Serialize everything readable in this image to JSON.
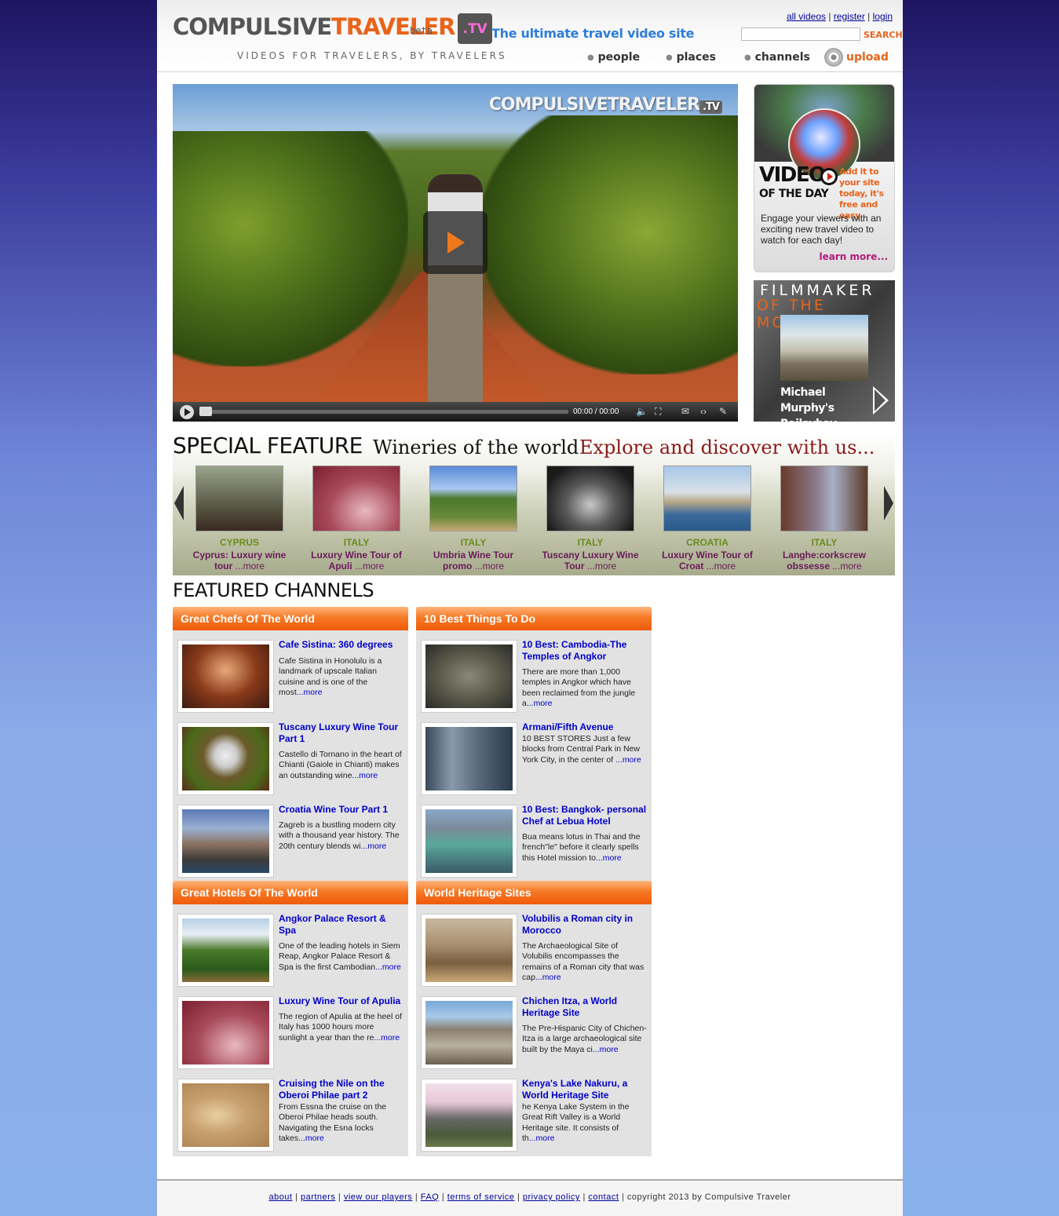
{
  "header": {
    "logo_part1": "COMPULSIVE",
    "logo_part2": "TRAVELER",
    "logo_tv": ".TV",
    "beta": "beta",
    "sub_tagline": "VIDEOS FOR TRAVELERS, BY TRAVELERS",
    "main_tagline": "The ultimate travel video site",
    "links": {
      "all_videos": "all videos",
      "register": "register",
      "login": "login",
      "sep": "|"
    },
    "search": {
      "placeholder": "",
      "button": "SEARCH"
    },
    "nav": {
      "people": "people",
      "places": "places",
      "channels": "channels",
      "upload": "upload"
    }
  },
  "player": {
    "watermark": "COMPULSIVETRAVELER",
    "watermark_tv": ".TV",
    "time": "00:00 / 00:00"
  },
  "votd": {
    "title_line1": "VIDEO",
    "title_line2": "OF THE DAY",
    "add_text": "Add it to your site today, it's free and easy",
    "description": "Engage your viewers with an exciting new travel video to watch for each day!",
    "learn_more": "learn more..."
  },
  "fotm": {
    "title_line1": "FILMMAKER",
    "title_line2": "OF THE MONTH",
    "name": "Michael Murphy's Railaybay"
  },
  "special_feature": {
    "title": "SPECIAL FEATURE",
    "subtitle": "Wineries of the world",
    "tagline": "Explore and discover with us...",
    "items": [
      {
        "country": "CYPRUS",
        "caption": "Cyprus: Luxury wine tour",
        "more": "...more"
      },
      {
        "country": "ITALY",
        "caption": "Luxury Wine Tour of Apuli",
        "more": "...more"
      },
      {
        "country": "ITALY",
        "caption": "Umbria Wine Tour promo",
        "more": "...more"
      },
      {
        "country": "ITALY",
        "caption": "Tuscany Luxury Wine Tour",
        "more": "...more"
      },
      {
        "country": "CROATIA",
        "caption": "Luxury Wine Tour of Croat",
        "more": "...more"
      },
      {
        "country": "ITALY",
        "caption": "Langhe:corkscrew obssesse",
        "more": "...more"
      }
    ]
  },
  "featured_channels": {
    "title": "FEATURED CHANNELS",
    "channels": [
      {
        "name": "Great Chefs Of The World",
        "items": [
          {
            "title": "Cafe Sistina: 360 degrees",
            "desc": "Cafe Sistina in Honolulu is a landmark of upscale Italian cuisine and is one of the most",
            "more": "...more"
          },
          {
            "title": "Tuscany Luxury Wine Tour Part 1",
            "desc": "Castello di Tornano in the heart of Chianti (Gaiole in Chianti) makes an outstanding wine",
            "more": "...more"
          },
          {
            "title": "Croatia Wine Tour Part 1",
            "desc": "Zagreb is a bustling modern city with a thousand year history. The 20th century blends wi",
            "more": "...more"
          }
        ]
      },
      {
        "name": "10 Best Things To Do",
        "items": [
          {
            "title": "10 Best: Cambodia-The Temples of Angkor",
            "desc": "There are more than 1,000 temples in Angkor which have been reclaimed from the jungle a",
            "more": "...more"
          },
          {
            "title": "Armani/Fifth Avenue",
            "desc": "10 BEST STORES Just a few blocks from Central Park in New York City, in the center of ",
            "more": "...more"
          },
          {
            "title": "10 Best: Bangkok- personal Chef at Lebua Hotel",
            "desc": "Bua means lotus in Thai and the french\"le\" before it clearly spells this Hotel mission to",
            "more": "...more"
          }
        ]
      },
      {
        "name": "Great Hotels Of The World",
        "items": [
          {
            "title": "Angkor Palace Resort & Spa",
            "desc": "One of the leading hotels in Siem Reap, Angkor Palace Resort & Spa is the first Cambodian",
            "more": "...more"
          },
          {
            "title": "Luxury Wine Tour of Apulia",
            "desc": "The region of Apulia at the heel of Italy has 1000 hours more sunlight a year than the re",
            "more": "...more"
          },
          {
            "title": "Cruising the Nile on the Oberoi Philae part 2",
            "desc": "From Essna the cruise on the Oberoi Philae heads south. Navigating the Esna locks takes",
            "more": "...more"
          }
        ]
      },
      {
        "name": "World Heritage Sites",
        "items": [
          {
            "title": "Volubilis a Roman city in Morocco",
            "desc": "The Archaeological Site of Volubilis encompasses the remains of a Roman city that was cap",
            "more": "...more"
          },
          {
            "title": "Chichen Itza, a World Heritage Site",
            "desc": "The Pre-Hispanic City of Chichen-Itza is a large archaeological site built by the Maya ci",
            "more": "...more"
          },
          {
            "title": "Kenya's Lake Nakuru, a World Heritage Site",
            "desc": "he Kenya Lake System in the Great Rift Valley is a World Heritage site. It consists of th",
            "more": "...more"
          }
        ]
      }
    ]
  },
  "footer": {
    "links": [
      "about",
      "partners",
      "view our players",
      "FAQ",
      "terms of service",
      "privacy policy",
      "contact"
    ],
    "copyright": "copyright 2013 by Compulsive Traveler"
  },
  "colors": {
    "brand_orange": "#e8641b",
    "tagline_blue": "#2f7ed8",
    "link_blue": "#0000c8",
    "country_green": "#6b8b1c",
    "caption_purple": "#6a1a5a"
  }
}
